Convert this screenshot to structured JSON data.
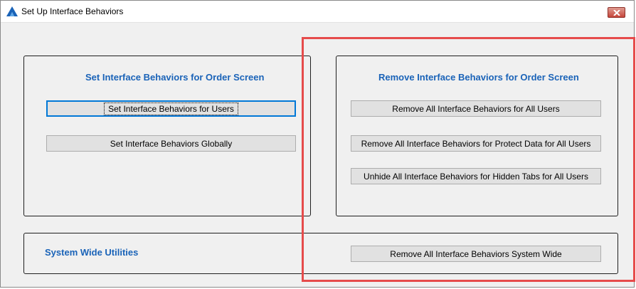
{
  "window": {
    "title": "Set Up Interface Behaviors"
  },
  "order_screen_group": {
    "title": "Set Interface Behaviors for Order Screen",
    "buttons": [
      {
        "label": "Set Interface Behaviors for Users"
      },
      {
        "label": "Set Interface Behaviors Globally"
      }
    ]
  },
  "remove_group": {
    "title": "Remove Interface Behaviors for Order Screen",
    "buttons": [
      {
        "label": "Remove All Interface Behaviors for All Users"
      },
      {
        "label": "Remove All Interface Behaviors for Protect Data for All Users"
      },
      {
        "label": "Unhide All Interface Behaviors for Hidden Tabs for All Users"
      }
    ]
  },
  "system_wide_group": {
    "title": "System Wide Utilities",
    "buttons": [
      {
        "label": "Remove All Interface Behaviors System Wide"
      }
    ]
  },
  "colors": {
    "group_title": "#1a63b8",
    "highlight_box": "#e64b4b",
    "close_button": "#c6463b"
  },
  "icons": [
    "app-icon",
    "close-icon"
  ]
}
